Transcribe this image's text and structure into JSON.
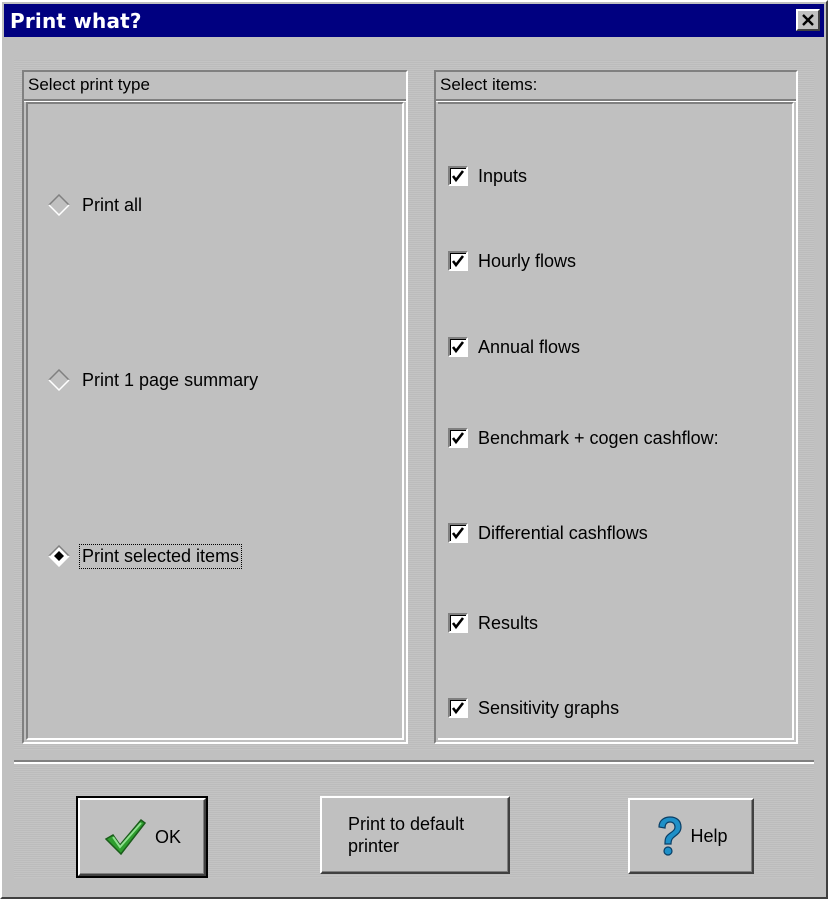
{
  "window": {
    "title": "Print what?"
  },
  "print_type": {
    "header": "Select print type",
    "options": [
      {
        "label": "Print all",
        "selected": false
      },
      {
        "label": "Print 1 page summary",
        "selected": false
      },
      {
        "label": "Print selected items",
        "selected": true
      }
    ]
  },
  "items": {
    "header": "Select items:",
    "list": [
      {
        "label": "Inputs",
        "checked": true
      },
      {
        "label": "Hourly flows",
        "checked": true
      },
      {
        "label": "Annual flows",
        "checked": true
      },
      {
        "label": "Benchmark + cogen cashflow:",
        "checked": true
      },
      {
        "label": "Differential cashflows",
        "checked": true
      },
      {
        "label": "Results",
        "checked": true
      },
      {
        "label": "Sensitivity graphs",
        "checked": true
      }
    ]
  },
  "buttons": {
    "ok": "OK",
    "print_default_line1": "Print to default",
    "print_default_line2": "printer",
    "help": "Help"
  },
  "icons": {
    "ok": "checkmark-icon",
    "help": "question-mark-icon",
    "close": "close-icon"
  },
  "colors": {
    "titlebar": "#000080",
    "face": "#c0c0c0",
    "ok_check": "#2e9e2e",
    "help_q": "#1e90c8"
  }
}
